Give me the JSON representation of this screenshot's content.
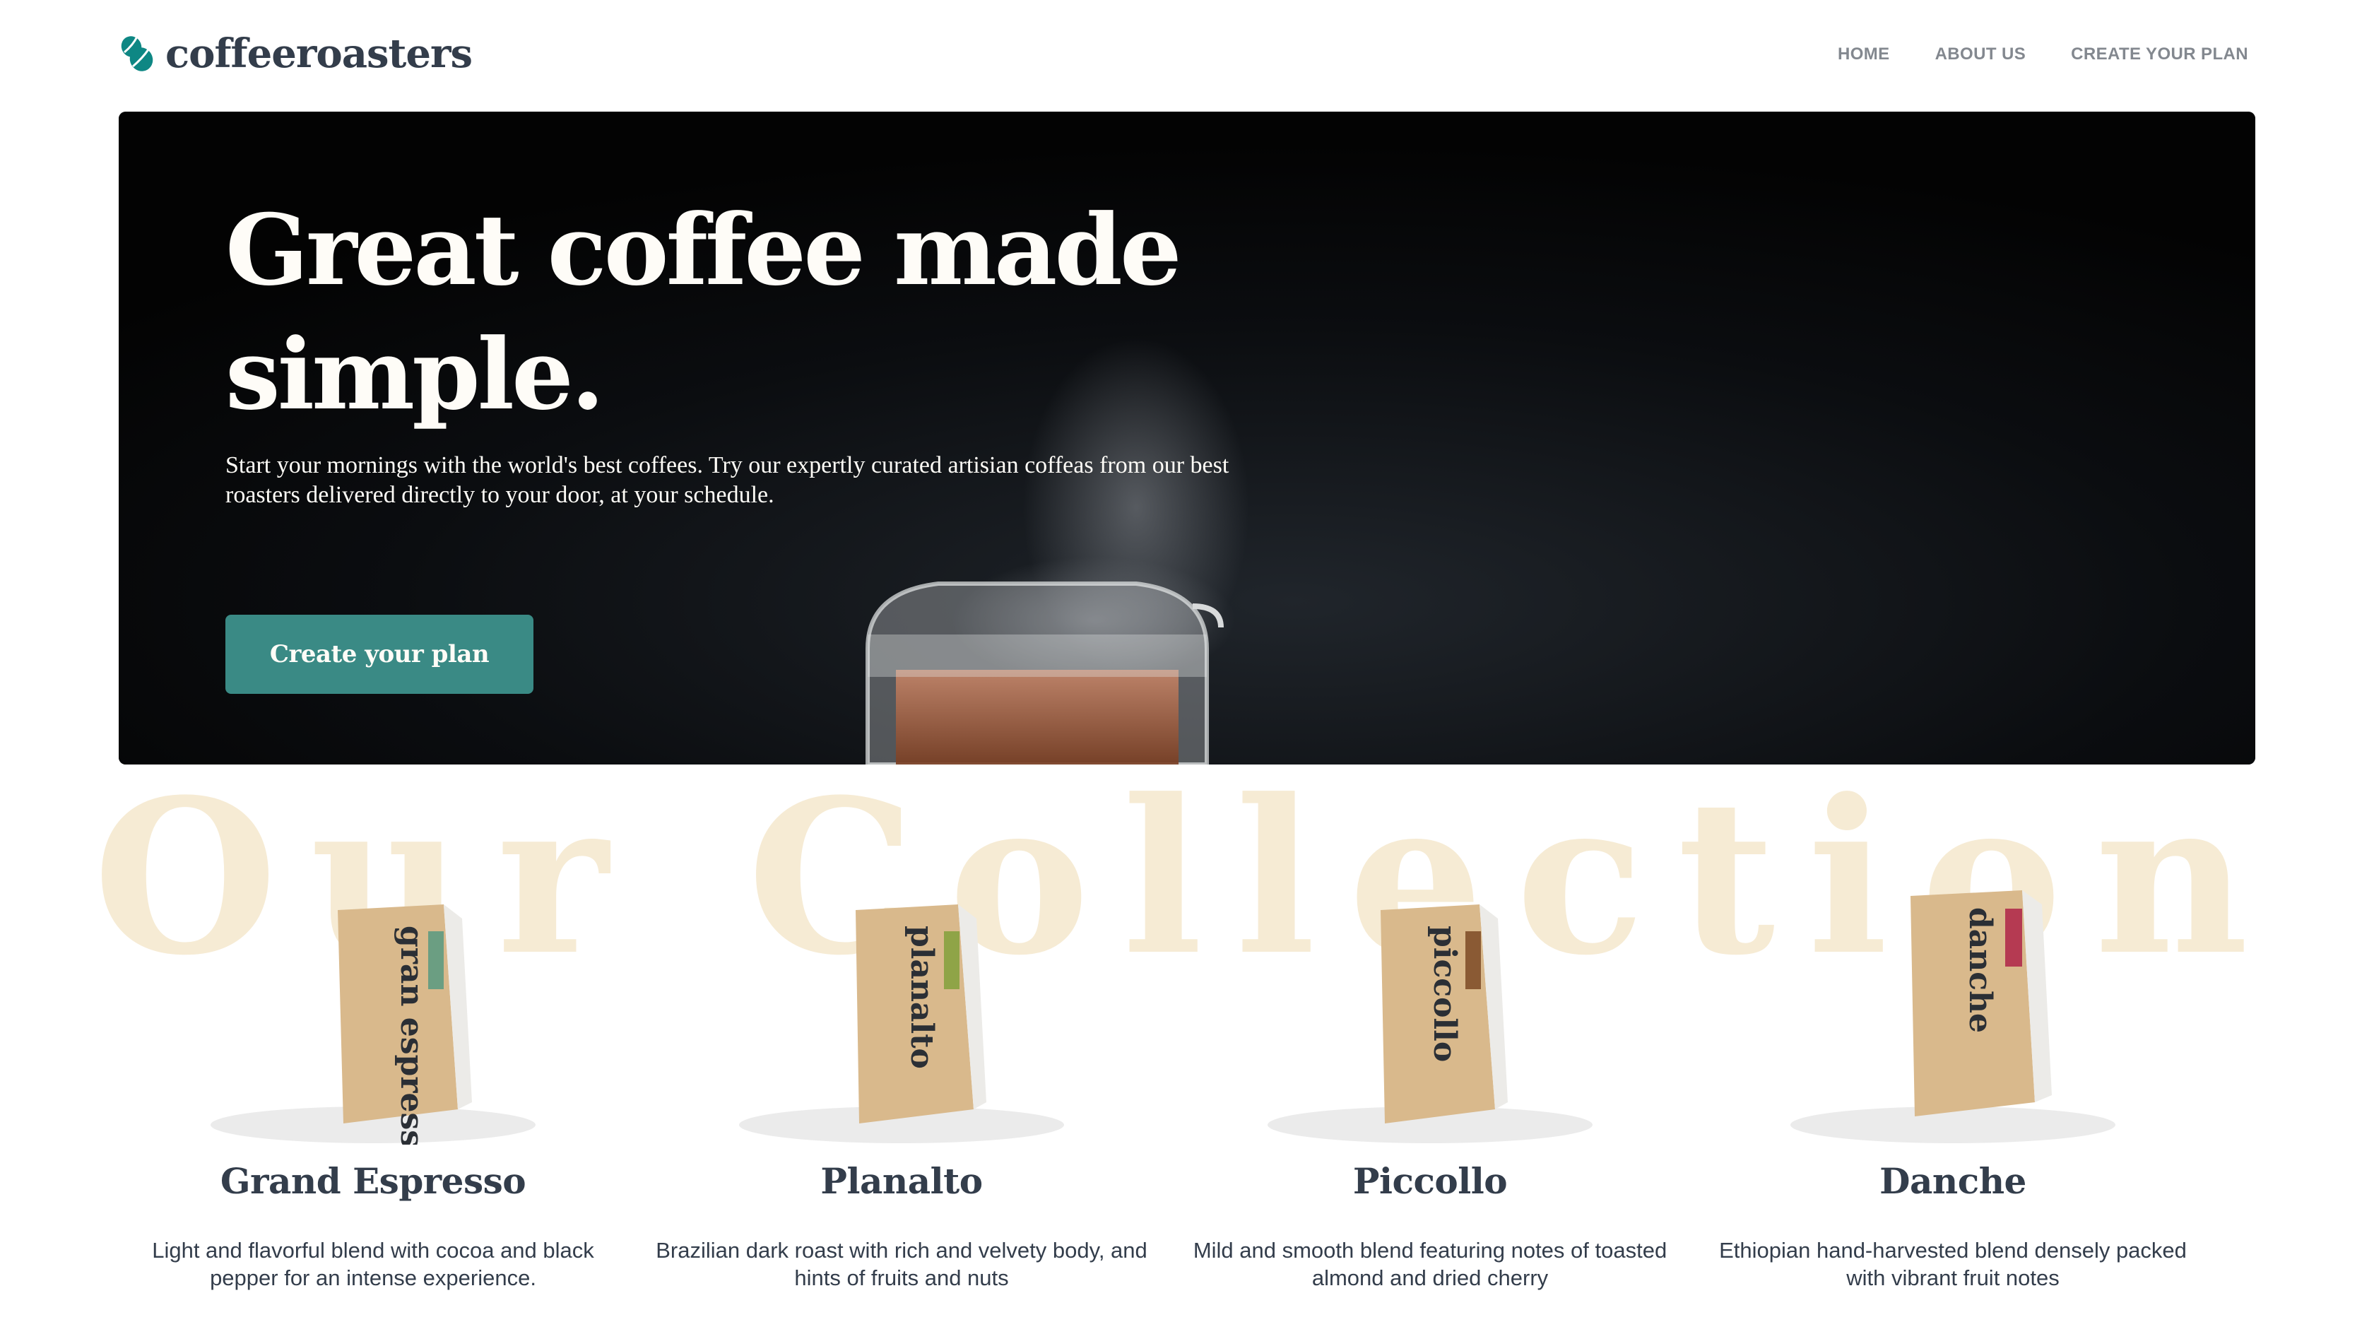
{
  "header": {
    "logo_text": "coffeeroasters",
    "nav": [
      "HOME",
      "ABOUT US",
      "CREATE YOUR PLAN"
    ]
  },
  "hero": {
    "title": "Great coffee made simple.",
    "description": "Start your mornings with the world's best coffees. Try our expertly curated artisian coffeas from our best roasters delivered directly to your door, at your schedule.",
    "cta_label": "Create your plan"
  },
  "collection": {
    "heading": "Our Collection",
    "products": [
      {
        "name": "Grand Espresso",
        "pack_label": "gran espresso",
        "description": "Light and flavorful blend with cocoa and black pepper for an intense experience.",
        "tag_color": "#6b9e82"
      },
      {
        "name": "Planalto",
        "pack_label": "planalto",
        "description": "Brazilian dark roast with rich and velvety body, and hints of fruits and nuts",
        "tag_color": "#8fa447"
      },
      {
        "name": "Piccollo",
        "pack_label": "piccollo",
        "description": "Mild and smooth blend featuring notes of toasted almond and dried cherry",
        "tag_color": "#8a5a34"
      },
      {
        "name": "Danche",
        "pack_label": "danche",
        "description": "Ethiopian hand-harvested blend densely packed with vibrant fruit notes",
        "tag_color": "#b53a52"
      }
    ]
  },
  "colors": {
    "primary": "#333d4b",
    "accent": "#3a8a85",
    "cream": "#fefcf7",
    "watermark": "#f6ebd4",
    "nav": "#83888f"
  }
}
